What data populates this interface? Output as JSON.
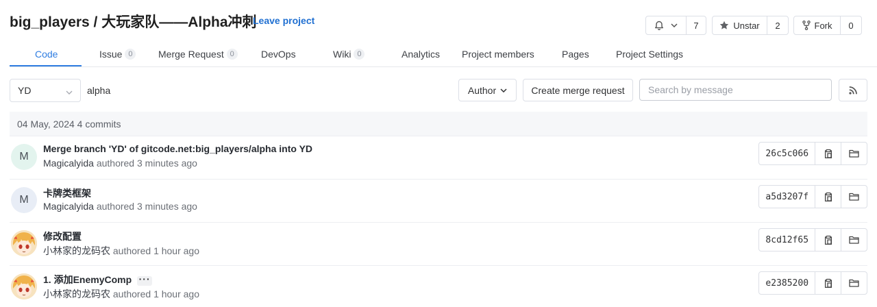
{
  "project": {
    "title": "big_players / 大玩家队——Alpha冲刺",
    "leave_label": "Leave project"
  },
  "actions": {
    "notify_count": "7",
    "unstar_label": "Unstar",
    "star_count": "2",
    "fork_label": "Fork",
    "fork_count": "0"
  },
  "tabs": [
    {
      "label": "Code"
    },
    {
      "label": "Issue",
      "count": "0"
    },
    {
      "label": "Merge Request",
      "count": "0"
    },
    {
      "label": "DevOps"
    },
    {
      "label": "Wiki",
      "count": "0"
    },
    {
      "label": "Analytics"
    },
    {
      "label": "Project members"
    },
    {
      "label": "Pages"
    },
    {
      "label": "Project Settings"
    }
  ],
  "filters": {
    "branch": "YD",
    "path": "alpha",
    "author_label": "Author",
    "create_mr_label": "Create merge request",
    "search_placeholder": "Search by message"
  },
  "date_header": "04 May, 2024 4 commits",
  "commits": [
    {
      "avatar_letter": "M",
      "title": "Merge branch 'YD' of gitcode.net:big_players/alpha into YD",
      "author": "Magicalyida",
      "authored": "authored",
      "time": "3 minutes ago",
      "sha": "26c5c066"
    },
    {
      "avatar_letter": "M",
      "title": "卡牌类框架",
      "author": "Magicalyida",
      "authored": "authored",
      "time": "3 minutes ago",
      "sha": "a5d3207f"
    },
    {
      "avatar_letter": "",
      "title": "修改配置",
      "author": "小林家的龙码农",
      "authored": "authored",
      "time": "1 hour ago",
      "sha": "8cd12f65"
    },
    {
      "avatar_letter": "",
      "title": "1. 添加EnemyComp",
      "author": "小林家的龙码农",
      "authored": "authored",
      "time": "1 hour ago",
      "sha": "e2385200",
      "more": "···"
    }
  ],
  "colors": {
    "accent": "#2f7de1",
    "link": "#1f6fd1"
  },
  "icons": [
    "bell-icon",
    "chevron-down-icon",
    "star-icon",
    "fork-icon",
    "rss-icon",
    "copy-icon",
    "folder-icon"
  ]
}
